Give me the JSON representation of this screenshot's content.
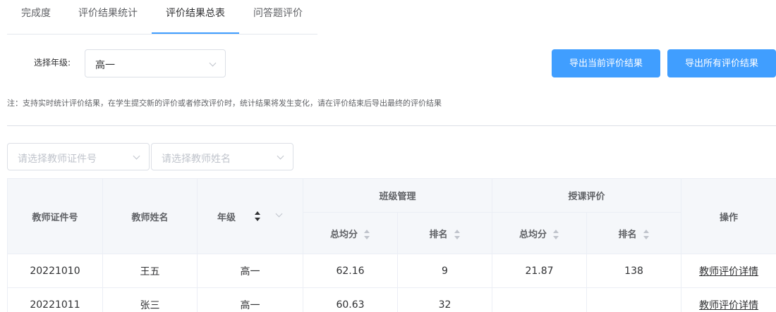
{
  "tabs": [
    {
      "label": "完成度"
    },
    {
      "label": "评价结果统计"
    },
    {
      "label": "评价结果总表",
      "active": true
    },
    {
      "label": "问答题评价"
    }
  ],
  "filters": {
    "grade_label": "选择年级:",
    "grade_value": "高一",
    "teacher_id_placeholder": "请选择教师证件号",
    "teacher_name_placeholder": "请选择教师姓名"
  },
  "actions": {
    "export_current": "导出当前评价结果",
    "export_all": "导出所有评价结果"
  },
  "note": "注：支持实时统计评价结果，在学生提交新的评价或者修改评价时，统计结果将发生变化，请在评价结束后导出最终的评价结果",
  "table": {
    "headers": {
      "teacher_id": "教师证件号",
      "teacher_name": "教师姓名",
      "grade": "年级",
      "class_mgmt": "班级管理",
      "teaching_eval": "授课评价",
      "operation": "操作",
      "avg_score": "总均分",
      "rank": "排名"
    },
    "rows": [
      {
        "teacher_id": "20221010",
        "teacher_name": "王五",
        "grade": "高一",
        "class_avg": "62.16",
        "class_rank": "9",
        "teach_avg": "21.87",
        "teach_rank": "138",
        "action": "教师评价详情"
      },
      {
        "teacher_id": "20221011",
        "teacher_name": "张三",
        "grade": "高一",
        "class_avg": "60.63",
        "class_rank": "32",
        "teach_avg": "",
        "teach_rank": "",
        "action": "教师评价详情"
      }
    ]
  },
  "colors": {
    "accent": "#409eff",
    "header_bg": "#f5f7fa",
    "border": "#ebeef5"
  }
}
